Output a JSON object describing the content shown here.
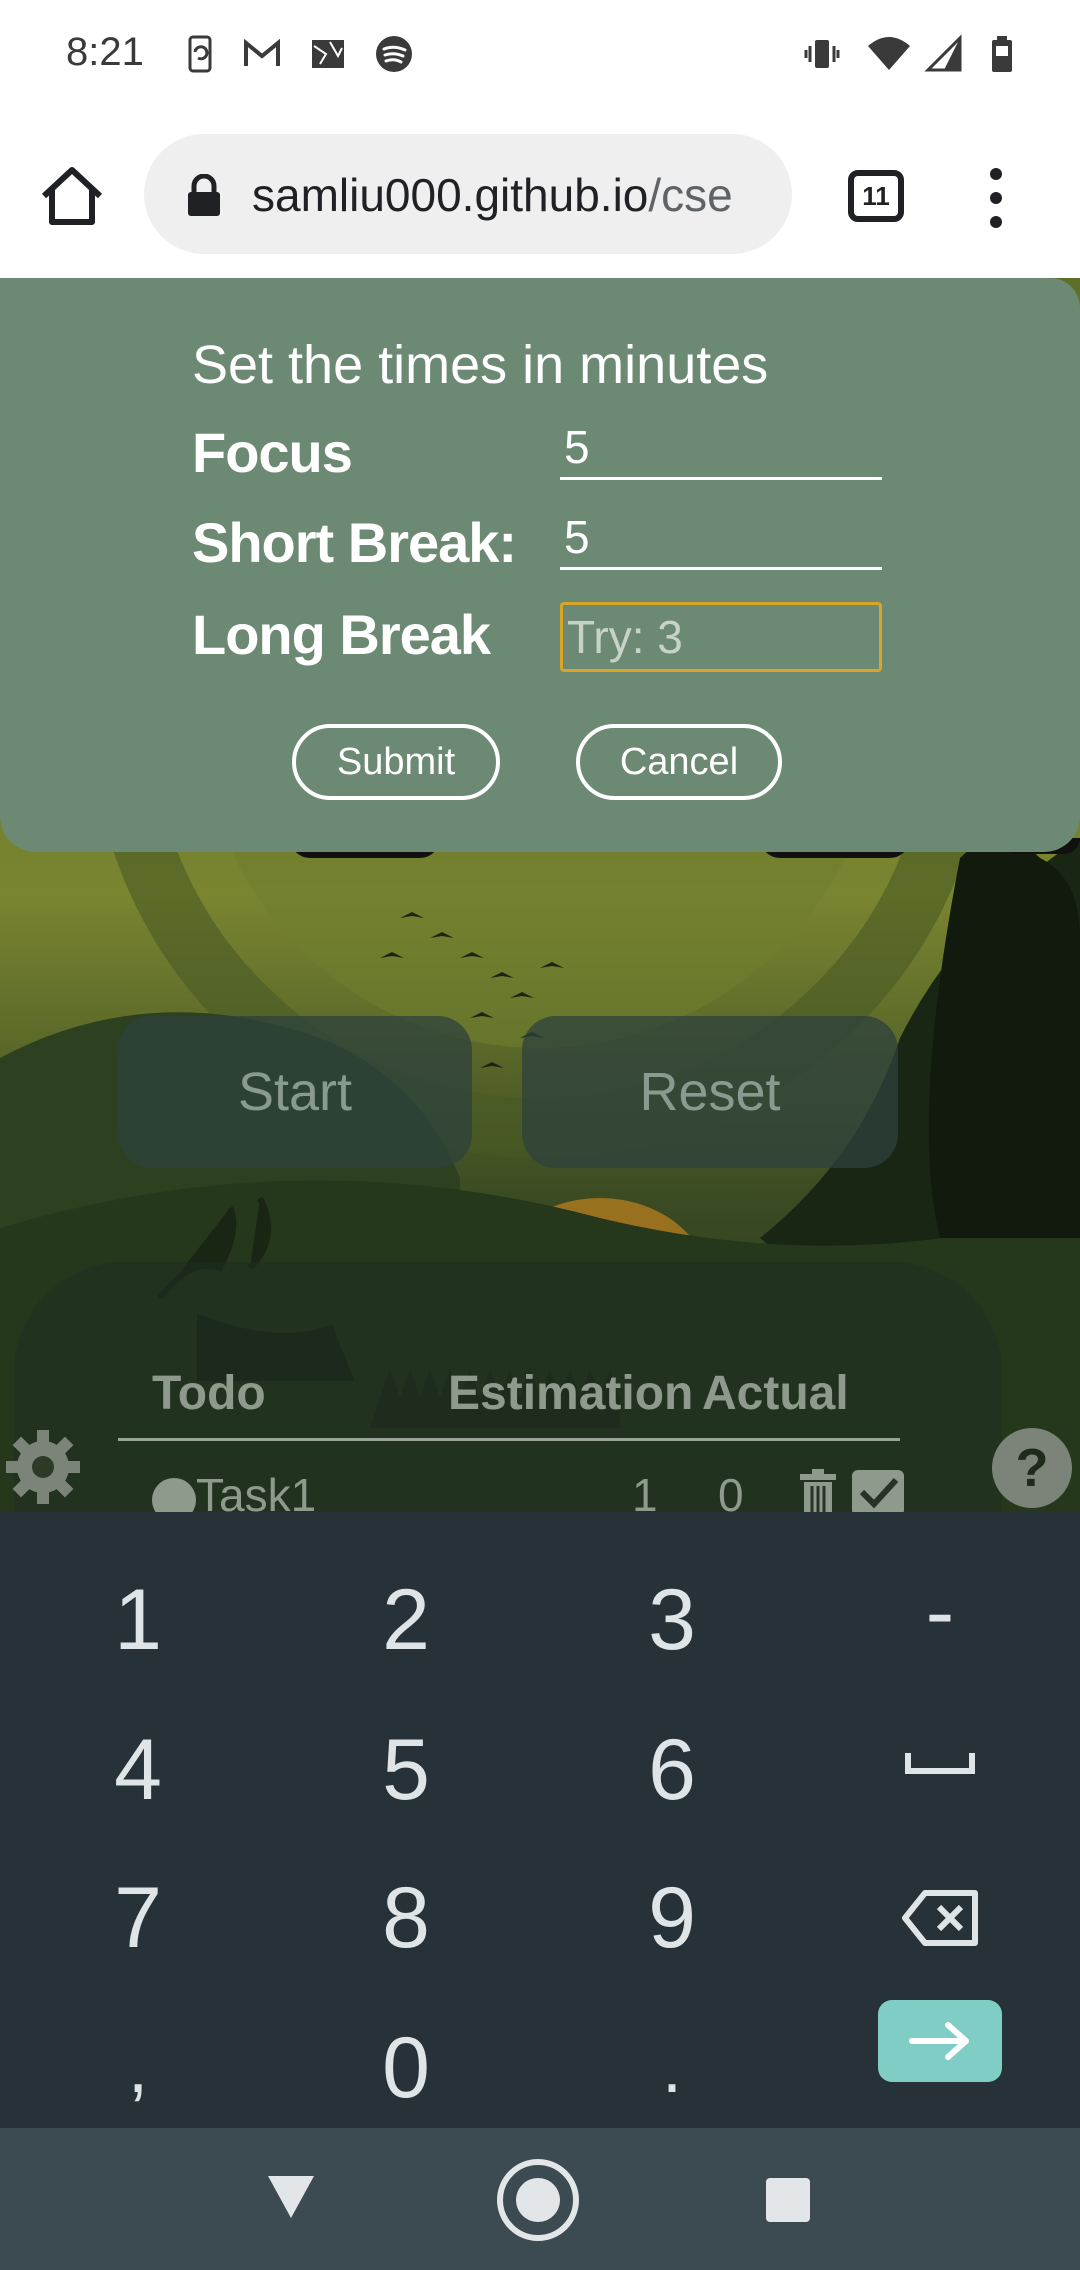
{
  "status_bar": {
    "time": "8:21"
  },
  "browser": {
    "url_host": "samliu000.github.io",
    "url_path": "/cse",
    "tab_count": "11"
  },
  "modal": {
    "title": "Set the times in minutes",
    "focus_label": "Focus",
    "focus_value": "5",
    "short_break_label": "Short Break:",
    "short_break_value": "5",
    "long_break_label": "Long Break",
    "long_break_placeholder": "Try: 3",
    "submit_label": "Submit",
    "cancel_label": "Cancel"
  },
  "timer": {
    "start_label": "Start",
    "reset_label": "Reset"
  },
  "todo": {
    "col_todo": "Todo",
    "col_estimation": "Estimation",
    "col_actual": "Actual",
    "tasks": [
      {
        "name": "Task1",
        "estimation": "1",
        "actual": "0"
      }
    ]
  },
  "keyboard": {
    "rows": [
      [
        "1",
        "2",
        "3",
        "-"
      ],
      [
        "4",
        "5",
        "6",
        "␣"
      ],
      [
        "7",
        "8",
        "9",
        "⌫"
      ],
      [
        ",",
        "0",
        ".",
        "→"
      ]
    ],
    "enter_color": "#7fcdc4"
  },
  "colors": {
    "modal_bg": "#6c8a73",
    "focus_outline": "#d9a528",
    "keyboard_bg": "#263238",
    "nav_bg": "#3c4a51"
  }
}
